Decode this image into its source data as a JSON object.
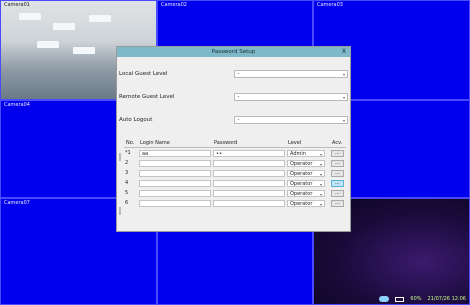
{
  "cameras": {
    "c1": "Camera01",
    "c2": "Camera02",
    "c3": "Camera03",
    "c4": "Camera04",
    "c7": "Camera07"
  },
  "status": {
    "percent": "60%",
    "datetime": "21/07/26 12:06"
  },
  "dialog": {
    "title": "Password Setup",
    "close": "X",
    "local_guest": {
      "label": "Local Guest Level",
      "value": "-"
    },
    "remote_guest": {
      "label": "Remote Guest Level",
      "value": "-"
    },
    "auto_logout": {
      "label": "Auto Logout",
      "value": "-"
    },
    "columns": [
      "No.",
      "Login Name",
      "Password",
      "Level",
      "Acv."
    ],
    "rows": [
      {
        "no": "*1",
        "login": "aa",
        "password": "••",
        "level": "Admin",
        "btn": "..."
      },
      {
        "no": "2",
        "login": "",
        "password": "",
        "level": "Operator",
        "btn": "..."
      },
      {
        "no": "3",
        "login": "",
        "password": "",
        "level": "Operator",
        "btn": "..."
      },
      {
        "no": "4",
        "login": "",
        "password": "",
        "level": "Operator",
        "btn": "..."
      },
      {
        "no": "5",
        "login": "",
        "password": "",
        "level": "Operator",
        "btn": "..."
      },
      {
        "no": "6",
        "login": "",
        "password": "",
        "level": "Operator",
        "btn": "..."
      }
    ]
  }
}
